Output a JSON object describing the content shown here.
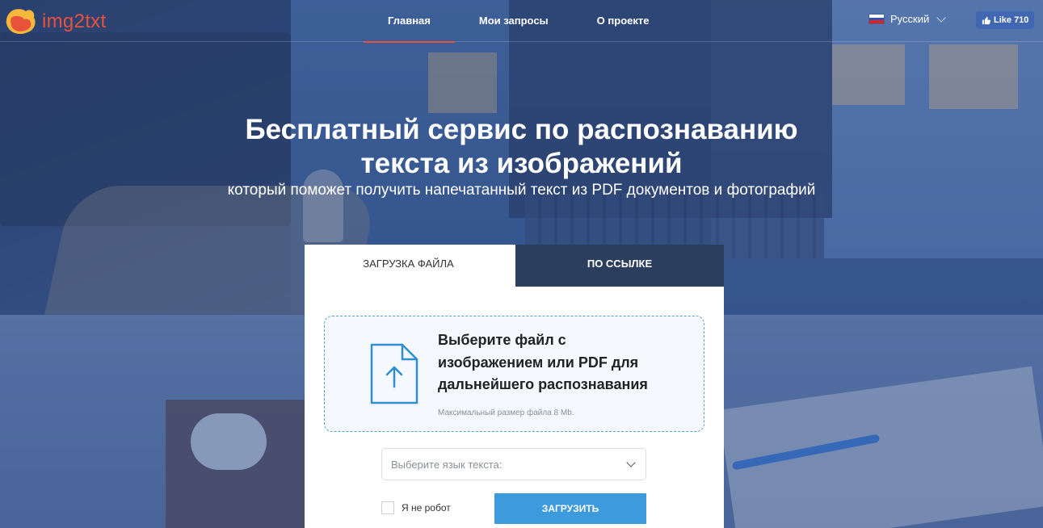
{
  "logo": {
    "text": "img2txt",
    "brand_color": "#e8523a"
  },
  "nav": {
    "items": [
      {
        "label": "Главная",
        "active": true
      },
      {
        "label": "Мои запросы",
        "active": false
      },
      {
        "label": "О проекте",
        "active": false
      }
    ]
  },
  "language": {
    "label": "Русский",
    "flag": "russia-flag-icon"
  },
  "facebook": {
    "label": "Like 710",
    "icon": "thumbs-up-icon"
  },
  "hero": {
    "title_line1": "Бесплатный сервис по распознаванию",
    "title_line2": "текста из изображений",
    "subtitle": "который поможет получить напечатанный текст из PDF документов и фотографий"
  },
  "card": {
    "tabs": [
      {
        "label": "ЗАГРУЗКА ФАЙЛА",
        "active": true
      },
      {
        "label": "ПО ССЫЛКЕ",
        "active": false
      }
    ],
    "dropzone": {
      "icon": "file-upload-icon",
      "text": "Выберите файл с\nизображением или PDF для\nдальнейшего распознавания",
      "note": "Максимальный размер файла 8 Mb."
    },
    "language_select": {
      "placeholder": "Выберите язык текста:"
    },
    "captcha": {
      "label": "Я не робот",
      "checked": false
    },
    "upload_button": {
      "label": "ЗАГРУЗИТЬ",
      "color": "#3d9bdd"
    }
  }
}
